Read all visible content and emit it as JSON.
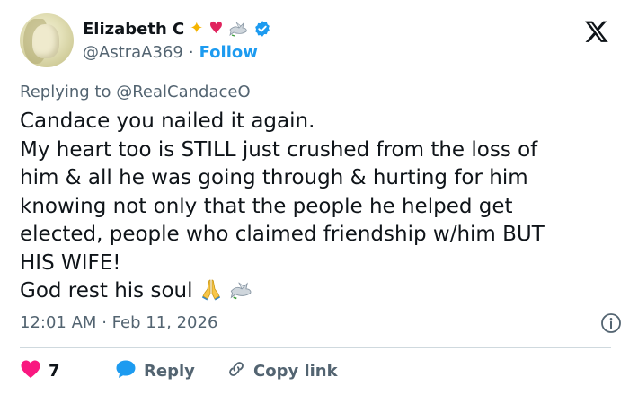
{
  "author": {
    "name": "Elizabeth C",
    "handle": "@AstraA369",
    "separator": "·",
    "follow_label": "Follow",
    "badge_icons": [
      "sparkles-icon",
      "red-heart-icon",
      "dove-icon",
      "verified-badge-icon"
    ]
  },
  "reply_to": {
    "prefix": "Replying to",
    "mention": "@RealCandaceO"
  },
  "body": {
    "lines": [
      "Candace you nailed it again.",
      "My heart too is STILL just crushed from the loss of",
      "him & all he was going through & hurting for him",
      "knowing not only that the people he helped get",
      "elected, people who claimed friendship w/him BUT",
      "HIS WIFE!",
      "God rest his soul"
    ],
    "trailing_emoji": [
      "folded-hands-icon",
      "dove-icon"
    ]
  },
  "timestamp": {
    "time": "12:01 AM",
    "separator": "·",
    "date": "Feb 11, 2026"
  },
  "actions": {
    "like_count": "7",
    "reply_label": "Reply",
    "copy_label": "Copy link"
  },
  "colors": {
    "accent": "#1d9bf0",
    "like": "#f91880",
    "secondary_text": "#536471",
    "primary_text": "#0f1419",
    "divider": "#cfd9de"
  }
}
